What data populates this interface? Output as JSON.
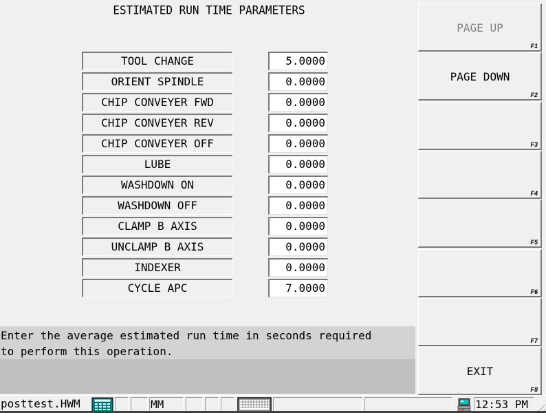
{
  "title": "ESTIMATED RUN TIME PARAMETERS",
  "parameters": [
    {
      "label": "TOOL CHANGE",
      "value": "5.0000"
    },
    {
      "label": "ORIENT SPINDLE",
      "value": "0.0000"
    },
    {
      "label": "CHIP CONVEYER FWD",
      "value": "0.0000"
    },
    {
      "label": "CHIP CONVEYER REV",
      "value": "0.0000"
    },
    {
      "label": "CHIP CONVEYER OFF",
      "value": "0.0000"
    },
    {
      "label": "LUBE",
      "value": "0.0000"
    },
    {
      "label": "WASHDOWN ON",
      "value": "0.0000"
    },
    {
      "label": "WASHDOWN OFF",
      "value": "0.0000"
    },
    {
      "label": "CLAMP B AXIS",
      "value": "0.0000"
    },
    {
      "label": "UNCLAMP B AXIS",
      "value": "0.0000"
    },
    {
      "label": "INDEXER",
      "value": "0.0000"
    },
    {
      "label": "CYCLE APC",
      "value": "7.0000"
    }
  ],
  "help_text": "Enter the average estimated run time in seconds required\nto perform this operation.",
  "function_keys": [
    {
      "key": "F1",
      "label": "PAGE UP",
      "enabled": false
    },
    {
      "key": "F2",
      "label": "PAGE DOWN",
      "enabled": true
    },
    {
      "key": "F3",
      "label": "",
      "enabled": true
    },
    {
      "key": "F4",
      "label": "",
      "enabled": true
    },
    {
      "key": "F5",
      "label": "",
      "enabled": true
    },
    {
      "key": "F6",
      "label": "",
      "enabled": true
    },
    {
      "key": "F7",
      "label": "",
      "enabled": true
    },
    {
      "key": "F8",
      "label": "EXIT",
      "enabled": true
    }
  ],
  "statusbar": {
    "filename": "posttest.HWM",
    "calculator_icon": "calculator-icon",
    "units": "MM",
    "keyboard_icon": "keyboard-icon",
    "computer_icon": "computer-icon",
    "time": "12:53 PM"
  }
}
